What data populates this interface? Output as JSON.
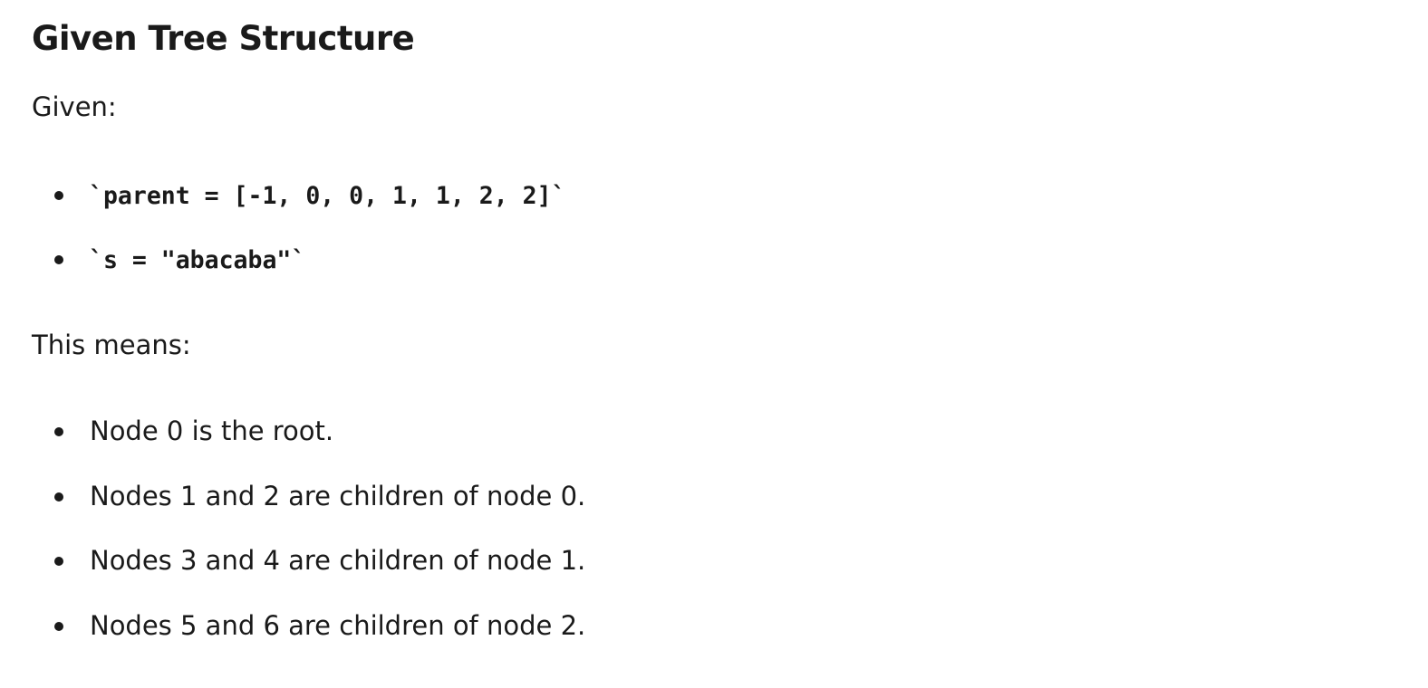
{
  "heading": "Given Tree Structure",
  "given_label": "Given:",
  "given_items": [
    "`parent = [-1, 0, 0, 1, 1, 2, 2]`",
    "`s = \"abacaba\"`"
  ],
  "means_label": "This means:",
  "means_items": [
    "Node 0 is the root.",
    "Nodes 1 and 2 are children of node 0.",
    "Nodes 3 and 4 are children of node 1.",
    "Nodes 5 and 6 are children of node 2."
  ]
}
